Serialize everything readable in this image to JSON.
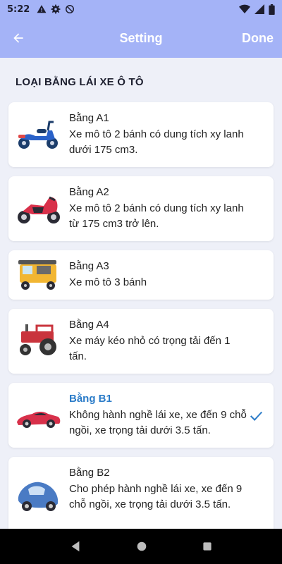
{
  "status_bar": {
    "time": "5:22",
    "icons": [
      "warning-icon",
      "gear-icon",
      "do-not-disturb-icon",
      "wifi-icon",
      "signal-icon",
      "battery-icon"
    ]
  },
  "toolbar": {
    "title": "Setting",
    "done_label": "Done",
    "background_color": "#a4b3f7"
  },
  "section": {
    "title": "LOẠI BẰNG LÁI XE Ô TÔ"
  },
  "licenses": [
    {
      "name": "Bằng A1",
      "desc": "Xe mô tô 2 bánh có dung tích xy lanh dưới 175 cm3.",
      "vehicle": "scooter-icon",
      "selected": false
    },
    {
      "name": "Bằng A2",
      "desc": "Xe mô tô 2 bánh có dung tích xy lanh từ 175 cm3 trở lên.",
      "vehicle": "motorbike-icon",
      "selected": false
    },
    {
      "name": "Bằng A3",
      "desc": "Xe mô tô 3 bánh",
      "vehicle": "tuk-tuk-icon",
      "selected": false
    },
    {
      "name": "Bằng A4",
      "desc": "Xe máy kéo nhỏ có trọng tải đến 1 tấn.",
      "vehicle": "tractor-icon",
      "selected": false
    },
    {
      "name": "Bằng B1",
      "desc": "Không hành nghề lái xe, xe đến 9 chỗ ngồi, xe trọng tải dưới 3.5 tấn.",
      "vehicle": "sports-car-icon",
      "selected": true
    },
    {
      "name": "Bằng B2",
      "desc": "Cho phép hành nghề lái xe, xe đến 9 chỗ ngồi, xe trọng tải dưới 3.5 tấn.",
      "vehicle": "beetle-car-icon",
      "selected": false
    }
  ],
  "colors": {
    "selected_text": "#2a7bc8",
    "check": "#2a7bc8"
  }
}
